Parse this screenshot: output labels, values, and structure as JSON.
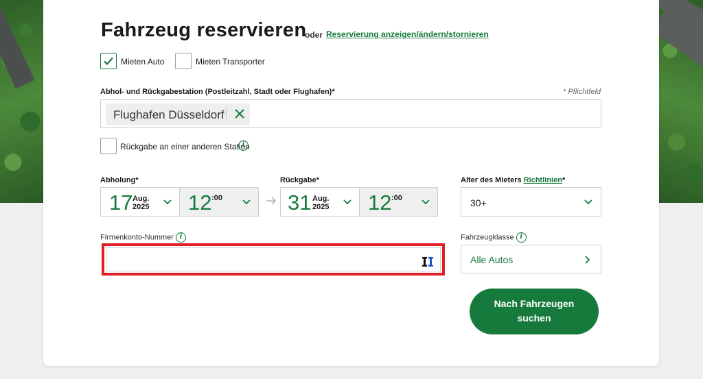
{
  "form": {
    "title": "Fahrzeug reservieren",
    "or_text": "oder",
    "manage_link": "Reservierung anzeigen/ändern/stornieren"
  },
  "vehicle_types": [
    {
      "label": "Mieten Auto",
      "checked": true
    },
    {
      "label": "Mieten Transporter",
      "checked": false
    }
  ],
  "station": {
    "label": "Abhol- und Rückgabestation (Postleitzahl, Stadt oder Flughafen)*",
    "required_note": "* Pflichtfeld",
    "selected": "Flughafen Düsseldorf",
    "return_other_label": "Rückgabe an einer anderen Station",
    "return_other_checked": false
  },
  "pickup": {
    "label": "Abholung*",
    "day": "17",
    "month": "Aug.",
    "year": "2025",
    "hour": "12",
    "minute": ":00"
  },
  "return": {
    "label": "Rückgabe*",
    "day": "31",
    "month": "Aug.",
    "year": "2025",
    "hour": "12",
    "minute": ":00"
  },
  "age": {
    "label": "Alter des Mieters",
    "link": "Richtlinien",
    "required": "*",
    "value": "30+"
  },
  "company_account": {
    "label": "Firmenkonto-Nummer",
    "value": "",
    "placeholder": ""
  },
  "vehicle_class": {
    "label": "Fahrzeugklasse",
    "value": "Alle Autos"
  },
  "search_button": {
    "line1": "Nach Fahrzeugen",
    "line2": "suchen"
  },
  "colors": {
    "brand_green": "#167a3c",
    "highlight_red": "#e31e24",
    "password_manager_blue": "#1a56db"
  }
}
